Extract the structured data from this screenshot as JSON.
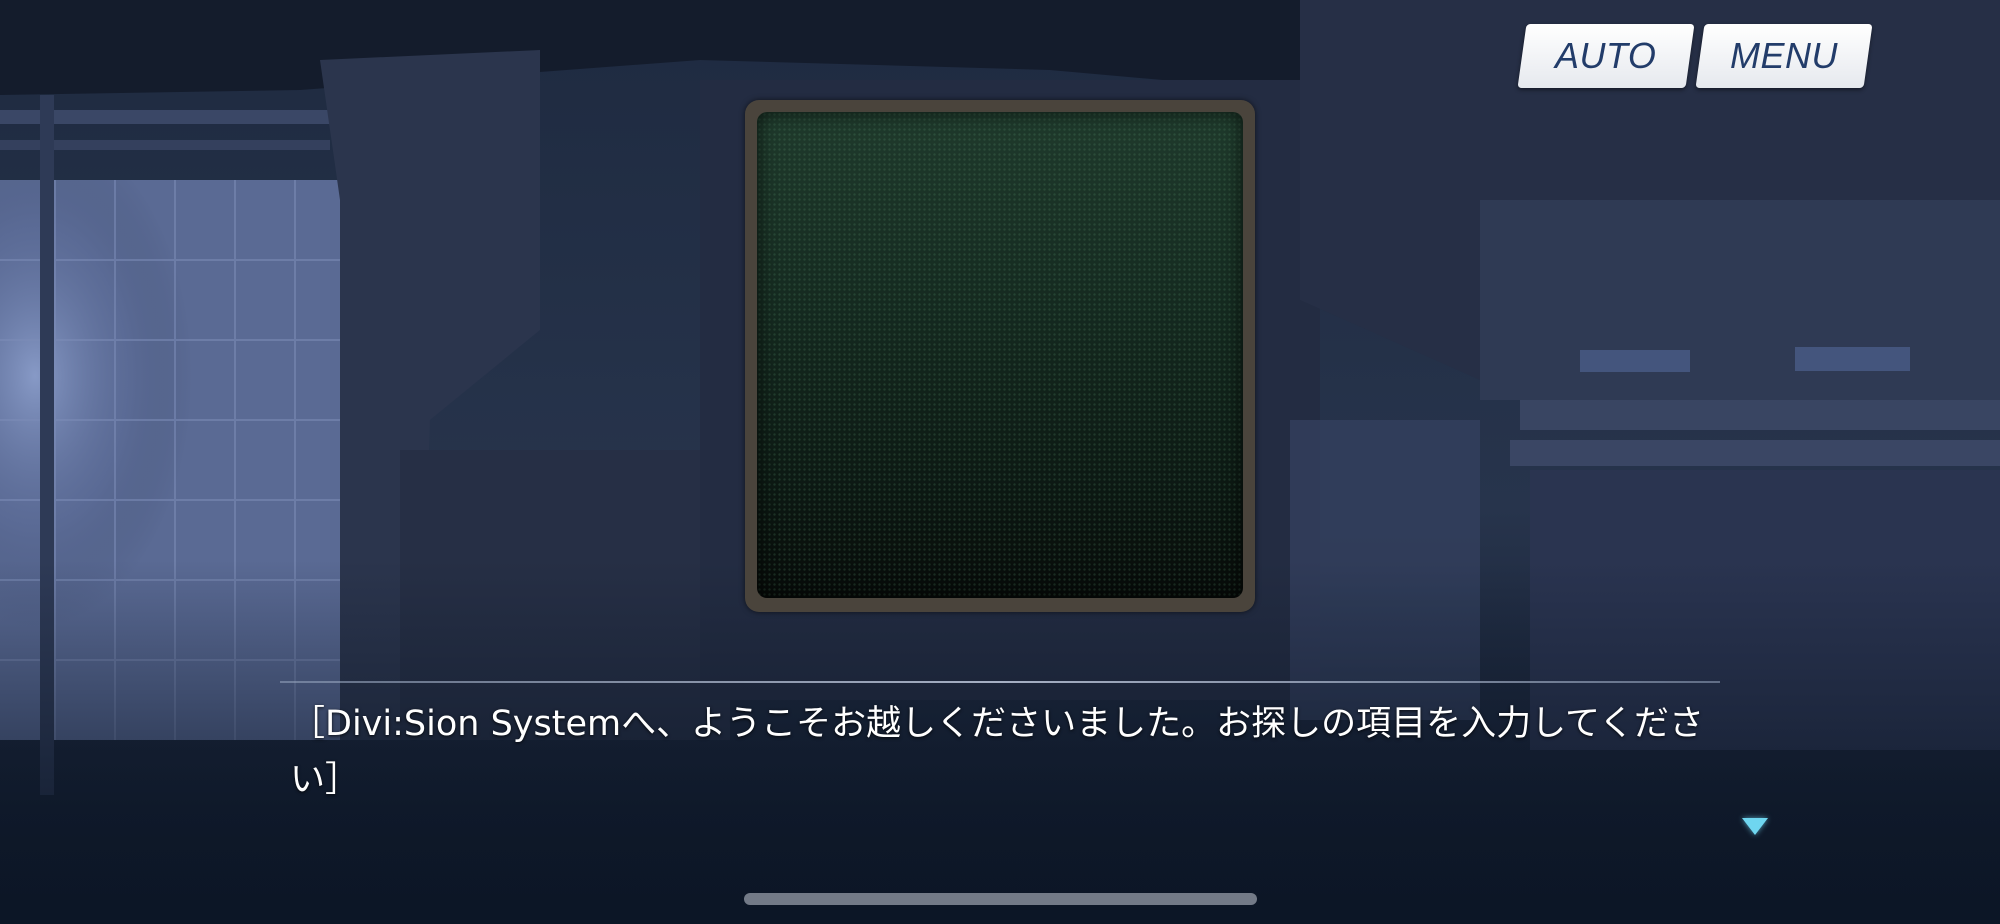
{
  "hud": {
    "auto_label": "AUTO",
    "menu_label": "MENU"
  },
  "dialogue": {
    "text": "［Divi:Sion Systemへ、ようこそお越しくださいました。お探しの項目を入力してください］"
  },
  "colors": {
    "button_text": "#223c6a",
    "button_bg": "#ffffff",
    "advance_indicator": "#6fd6f0",
    "terminal_screen": "#1f3a2c",
    "terminal_frame": "#4a443c"
  },
  "icons": {
    "advance": "triangle-down-icon"
  }
}
